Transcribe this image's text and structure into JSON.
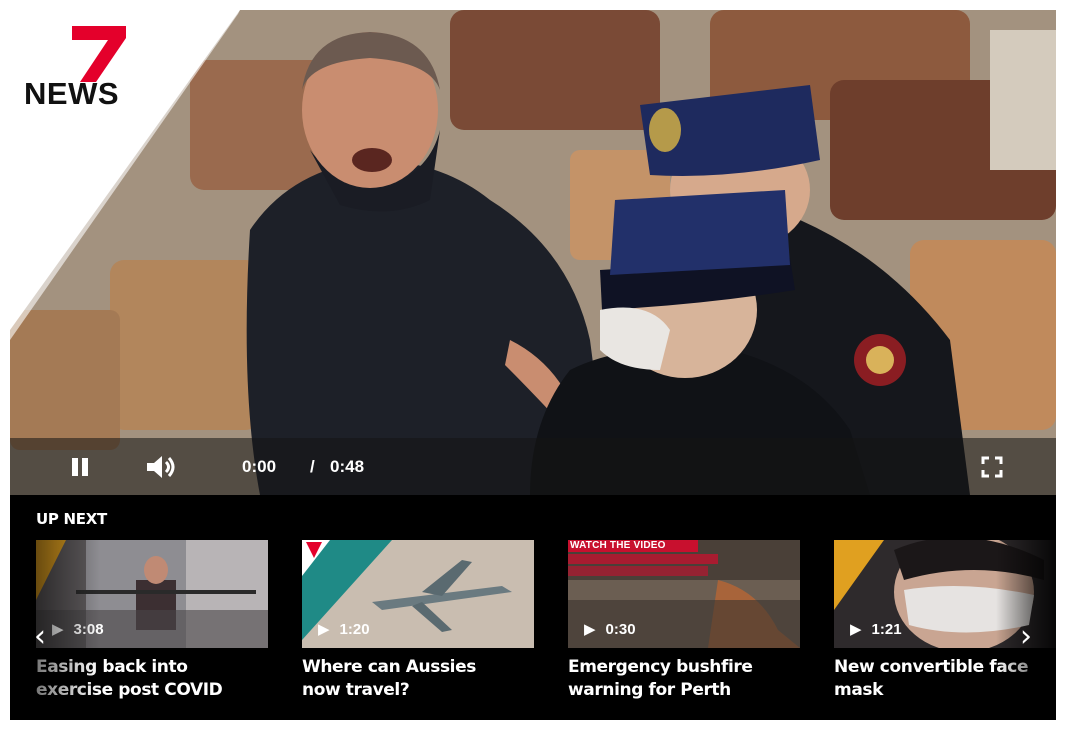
{
  "brand": {
    "logo_text": "NEWS",
    "logo_number": "7",
    "accent_color": "#e4002b"
  },
  "controls": {
    "pause_icon": "pause-icon",
    "volume_icon": "volume-icon",
    "current_time": "0:00",
    "separator": "/",
    "total_time": "0:48",
    "fullscreen_icon": "fullscreen-icon"
  },
  "up_next": {
    "label": "UP NEXT",
    "prev_arrow": "‹",
    "next_arrow": "›",
    "items": [
      {
        "duration": "3:08",
        "title_line1": "Easing back into",
        "title_line2": "exercise post COVID"
      },
      {
        "duration": "1:20",
        "title_line1": "Where can Aussies",
        "title_line2": "now travel?"
      },
      {
        "duration": "0:30",
        "title_line1": "Emergency bushfire",
        "title_line2": "warning for Perth",
        "thumb_overlay": "WATCH THE VIDEO"
      },
      {
        "duration": "1:21",
        "title_line1": "New convertible face",
        "title_line2": "mask"
      }
    ]
  }
}
